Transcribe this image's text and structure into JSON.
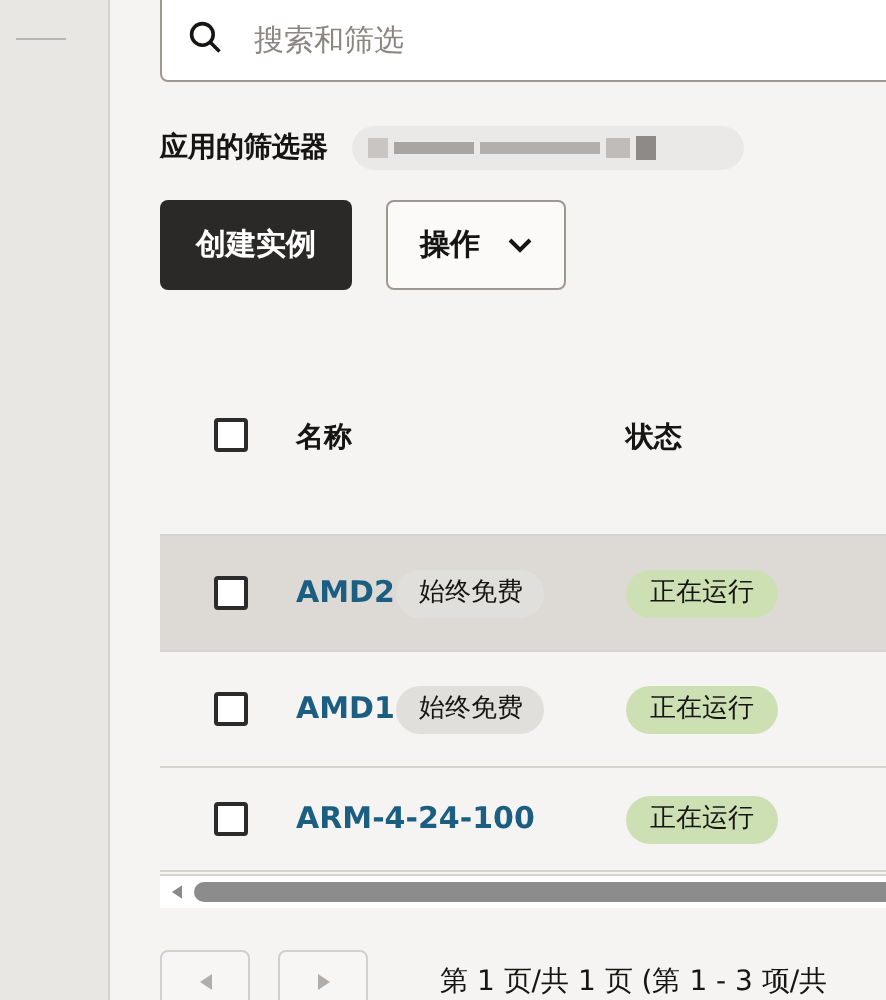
{
  "search": {
    "placeholder": "搜索和筛选"
  },
  "filters": {
    "label": "应用的筛选器",
    "value_redacted": true
  },
  "actions": {
    "create": "创建实例",
    "menu": "操作"
  },
  "table": {
    "columns": [
      "名称",
      "状态"
    ],
    "header_checked": false,
    "rows": [
      {
        "name": "AMD2",
        "tag": "始终免费",
        "status": "正在运行",
        "checked": false,
        "highlighted": true
      },
      {
        "name": "AMD1",
        "tag": "始终免费",
        "status": "正在运行",
        "checked": false,
        "highlighted": false
      },
      {
        "name": "ARM-4-24-100",
        "status": "正在运行",
        "checked": false,
        "highlighted": false
      }
    ]
  },
  "pagination": {
    "text": "第 1 页/共 1 页 (第 1 - 3 项/共"
  }
}
